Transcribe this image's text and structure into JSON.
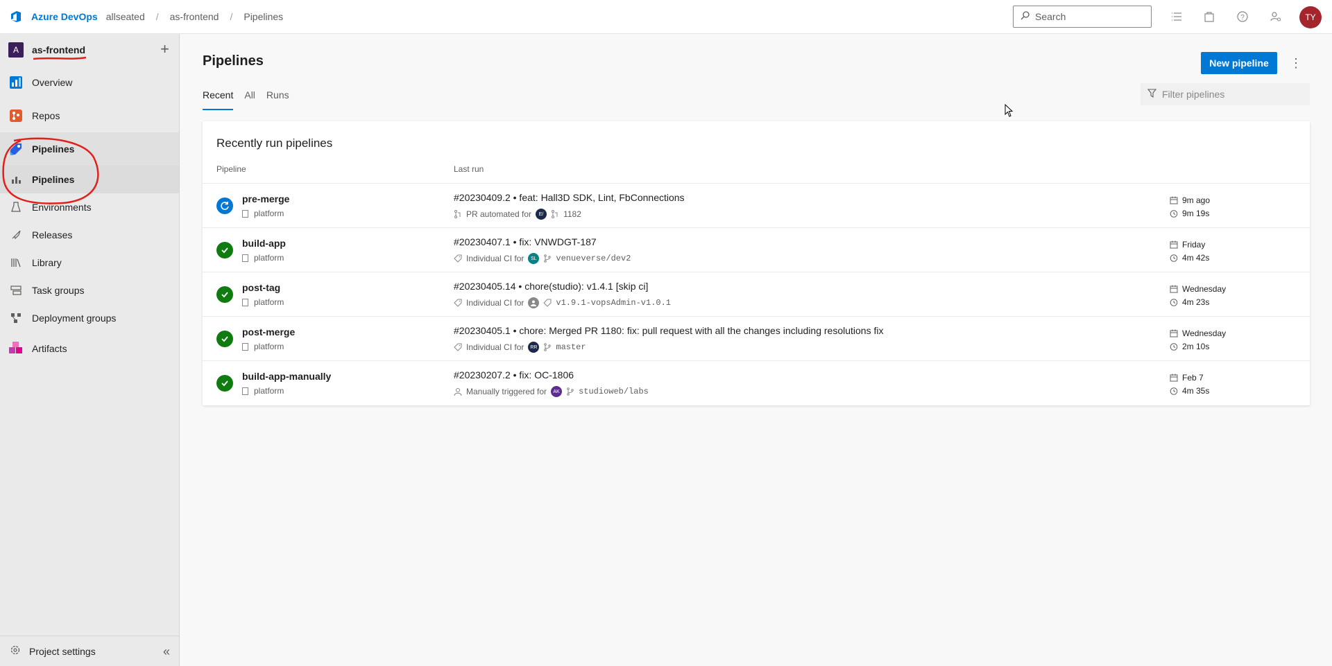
{
  "topbar": {
    "brand": "Azure DevOps",
    "crumbs": [
      "allseated",
      "as-frontend",
      "Pipelines"
    ],
    "search_placeholder": "Search",
    "avatar_initials": "TY"
  },
  "sidebar": {
    "project_initial": "A",
    "project_name": "as-frontend",
    "items": [
      {
        "label": "Overview"
      },
      {
        "label": "Repos"
      },
      {
        "label": "Pipelines"
      },
      {
        "label": "Pipelines"
      },
      {
        "label": "Environments"
      },
      {
        "label": "Releases"
      },
      {
        "label": "Library"
      },
      {
        "label": "Task groups"
      },
      {
        "label": "Deployment groups"
      },
      {
        "label": "Artifacts"
      }
    ],
    "project_settings": "Project settings"
  },
  "main": {
    "title": "Pipelines",
    "new_button": "New pipeline",
    "tabs": [
      "Recent",
      "All",
      "Runs"
    ],
    "filter_placeholder": "Filter pipelines",
    "card_title": "Recently run pipelines",
    "col_pipeline": "Pipeline",
    "col_last_run": "Last run"
  },
  "pipelines": [
    {
      "name": "pre-merge",
      "folder": "platform",
      "status": "running",
      "run_title": "#20230409.2 • feat: Hall3D SDK, Lint, FbConnections",
      "trigger": "PR automated for",
      "avatar": "E/",
      "avatar_color": "#1b2a4a",
      "ref": "1182",
      "when": "9m ago",
      "duration": "9m 19s"
    },
    {
      "name": "build-app",
      "folder": "platform",
      "status": "succeeded",
      "run_title": "#20230407.1 • fix: VNWDGT-187",
      "trigger": "Individual CI for",
      "avatar": "SL",
      "avatar_color": "#038387",
      "ref": "venueverse/dev2",
      "when": "Friday",
      "duration": "4m 42s"
    },
    {
      "name": "post-tag",
      "folder": "platform",
      "status": "succeeded",
      "run_title": "#20230405.14 • chore(studio): v1.4.1 [skip ci]",
      "trigger": "Individual CI for",
      "avatar": "",
      "avatar_color": "#8a8886",
      "ref": "v1.9.1-vopsAdmin-v1.0.1",
      "when": "Wednesday",
      "duration": "4m 23s"
    },
    {
      "name": "post-merge",
      "folder": "platform",
      "status": "succeeded",
      "run_title": "#20230405.1 • chore: Merged PR 1180: fix: pull request with all the changes including resolutions fix",
      "trigger": "Individual CI for",
      "avatar": "RR",
      "avatar_color": "#1b2a4a",
      "ref": "master",
      "when": "Wednesday",
      "duration": "2m 10s"
    },
    {
      "name": "build-app-manually",
      "folder": "platform",
      "status": "succeeded",
      "run_title": "#20230207.2 • fix: OC-1806",
      "trigger": "Manually triggered for",
      "avatar": "AK",
      "avatar_color": "#5c2d91",
      "ref": "studioweb/labs",
      "when": "Feb 7",
      "duration": "4m 35s"
    }
  ]
}
